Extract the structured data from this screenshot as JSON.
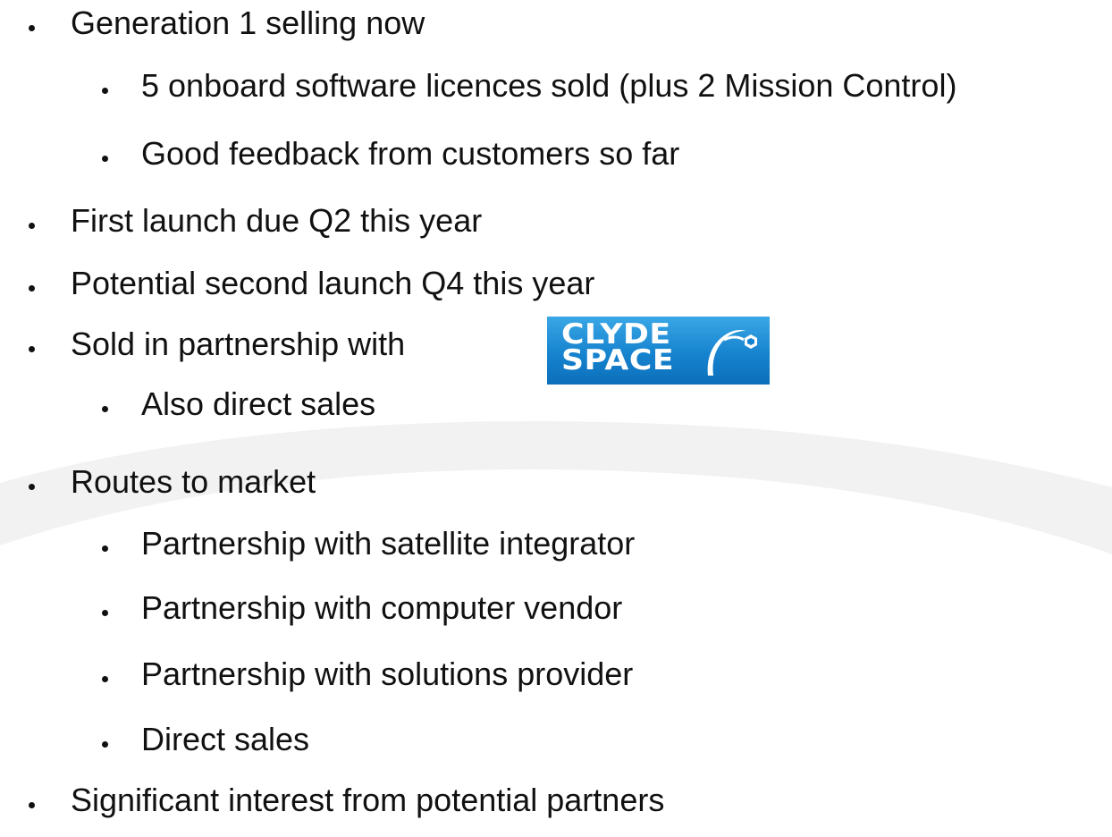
{
  "bullets": [
    {
      "text": "Generation 1 selling now",
      "level": 1
    },
    {
      "text": "5 onboard software licences sold (plus 2 Mission Control)",
      "level": 2
    },
    {
      "text": "Good feedback from customers so far",
      "level": 2
    },
    {
      "text": "First launch due Q2 this year",
      "level": 1
    },
    {
      "text": "Potential second launch Q4 this year",
      "level": 1
    },
    {
      "text": "Sold in partnership with",
      "level": 1
    },
    {
      "text": "Also direct sales",
      "level": 2
    },
    {
      "text": "Routes to market",
      "level": 1
    },
    {
      "text": "Partnership with satellite integrator",
      "level": 2
    },
    {
      "text": "Partnership with computer vendor",
      "level": 2
    },
    {
      "text": "Partnership with solutions provider",
      "level": 2
    },
    {
      "text": "Direct sales",
      "level": 2
    },
    {
      "text": "Significant interest from potential partners",
      "level": 1
    }
  ],
  "logo": {
    "line1": "CLYDE",
    "line2": "SPACE",
    "icon": "satellite-orbit-icon",
    "colors": {
      "top": "#3aa7e6",
      "bottom": "#0c6fbb",
      "text": "#ffffff"
    }
  },
  "colors": {
    "text": "#111111",
    "swoosh": "#f2f2f2"
  }
}
